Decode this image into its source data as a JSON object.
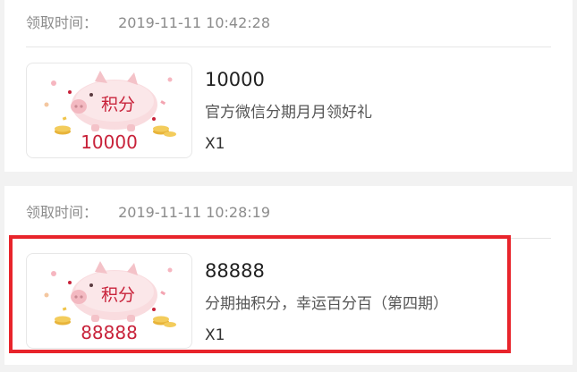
{
  "claims": [
    {
      "claim_label": "领取时间：",
      "claim_time": "2019-11-11 10:42:28",
      "thumb_badge": "积分",
      "thumb_amount": "10000",
      "points": "10000",
      "title": "官方微信分期月月领好礼",
      "quantity": "X1"
    },
    {
      "claim_label": "领取时间：",
      "claim_time": "2019-11-11 10:28:19",
      "thumb_badge": "积分",
      "thumb_amount": "88888",
      "points": "88888",
      "title": "分期抽积分，幸运百分百（第四期）",
      "quantity": "X1"
    }
  ],
  "colors": {
    "accent_red": "#c8223a",
    "highlight_border": "#e8242b",
    "pig_pink": "#f6cdd0",
    "coin_gold": "#f0c44a"
  }
}
